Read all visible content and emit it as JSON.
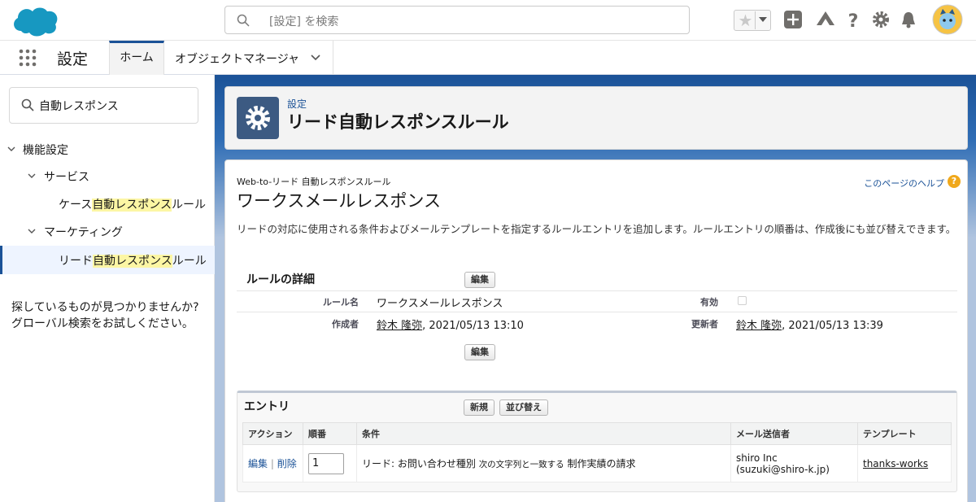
{
  "header": {
    "search_placeholder": "[設定] を検索",
    "icons": [
      "salesforce-cloud-icon",
      "search-icon",
      "star-icon",
      "add-icon",
      "trailhead-icon",
      "help-icon",
      "gear-icon",
      "bell-icon",
      "avatar"
    ]
  },
  "nav": {
    "app_name": "設定",
    "tabs": [
      {
        "label": "ホーム"
      },
      {
        "label": "オブジェクトマネージャ"
      }
    ]
  },
  "sidebar": {
    "quick_find_value": "自動レスポンス",
    "tree": {
      "root": "機能設定",
      "service": "サービス",
      "case_pre": "ケース",
      "case_hl": "自動レスポンス",
      "case_post": "ルール",
      "marketing": "マーケティング",
      "lead_pre": "リード",
      "lead_hl": "自動レスポンス",
      "lead_post": "ルール"
    },
    "not_found_line1": "探しているものが見つかりませんか?",
    "not_found_line2": "グローバル検索をお試しください。"
  },
  "page": {
    "breadcrumb": "設定",
    "title": "リード自動レスポンスルール",
    "subtitle": "Web-to-リード 自動レスポンスルール",
    "record_title": "ワークスメールレスポンス",
    "help_link": "このページのヘルプ",
    "help_icon": "?",
    "description": "リードの対応に使用される条件およびメールテンプレートを指定するルールエントリを追加します。ルールエントリの順番は、作成後にも並び替えできます。"
  },
  "details": {
    "section_title": "ルールの詳細",
    "edit_label": "編集",
    "rule_name_label": "ルール名",
    "rule_name": "ワークスメールレスポンス",
    "active_label": "有効",
    "active": false,
    "created_by_label": "作成者",
    "created_by_name": "鈴木 隆弥",
    "created_by_date": ", 2021/05/13 13:10",
    "modified_by_label": "更新者",
    "modified_by_name": "鈴木 隆弥",
    "modified_by_date": ", 2021/05/13 13:39"
  },
  "entries": {
    "section_title": "エントリ",
    "new_label": "新規",
    "reorder_label": "並び替え",
    "columns": [
      "アクション",
      "順番",
      "条件",
      "メール送信者",
      "テンプレート"
    ],
    "rows": [
      {
        "edit": "編集",
        "separator": "|",
        "delete": "削除",
        "order": "1",
        "cond_field": "リード: お問い合わせ種別",
        "cond_op": "次の文字列と一致する",
        "cond_value": "制作実績の請求",
        "sender_name": "shiro Inc",
        "sender_email": "(suzuki@shiro-k.jp)",
        "template": "thanks-works"
      }
    ]
  }
}
